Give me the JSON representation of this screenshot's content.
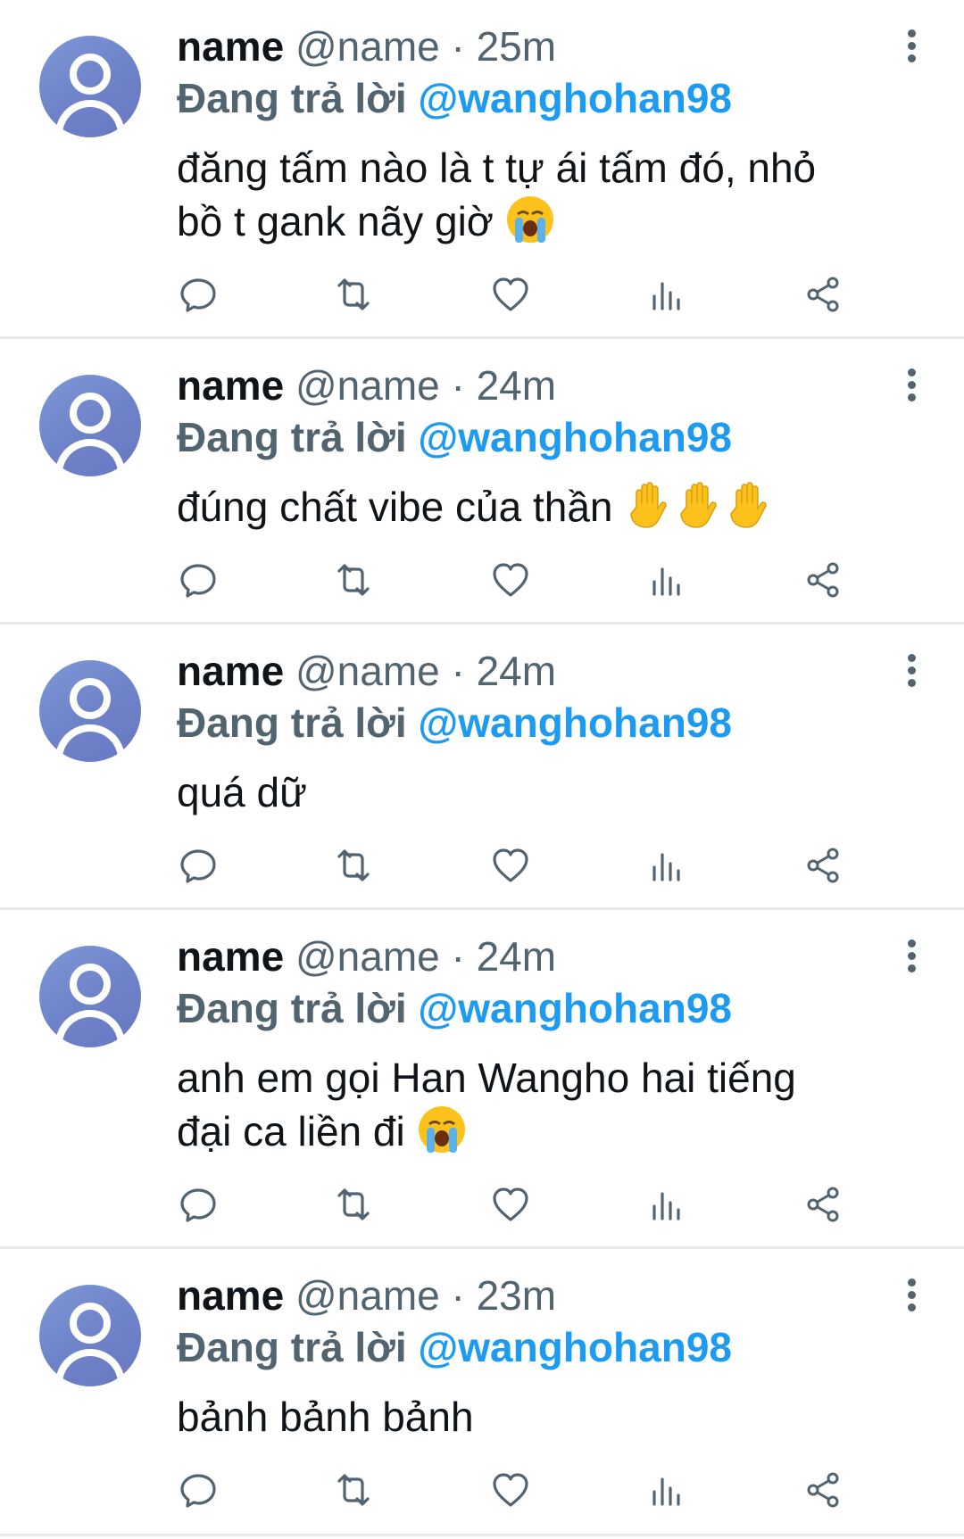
{
  "tweets": [
    {
      "name": "name",
      "handle": "@name",
      "time": "· 25m",
      "reply_prefix": "Đang trả lời",
      "reply_to": "@wanghohan98",
      "text_lines": [
        "đăng tấm nào là t tự ái tấm đó, nhỏ",
        "bồ t gank nãy giờ"
      ],
      "emojis": [
        "crying-face"
      ]
    },
    {
      "name": "name",
      "handle": "@name",
      "time": "· 24m",
      "reply_prefix": "Đang trả lời",
      "reply_to": "@wanghohan98",
      "text_lines": [
        "đúng chất vibe của thần"
      ],
      "emojis": [
        "raised-hand",
        "raised-hand",
        "raised-hand"
      ]
    },
    {
      "name": "name",
      "handle": "@name",
      "time": "· 24m",
      "reply_prefix": "Đang trả lời",
      "reply_to": "@wanghohan98",
      "text_lines": [
        "quá dữ"
      ],
      "emojis": []
    },
    {
      "name": "name",
      "handle": "@name",
      "time": "· 24m",
      "reply_prefix": "Đang trả lời",
      "reply_to": "@wanghohan98",
      "text_lines": [
        "anh em gọi Han Wangho hai tiếng",
        "đại ca liền đi"
      ],
      "emojis": [
        "crying-face"
      ]
    },
    {
      "name": "name",
      "handle": "@name",
      "time": "· 23m",
      "reply_prefix": "Đang trả lời",
      "reply_to": "@wanghohan98",
      "text_lines": [
        "bảnh bảnh bảnh"
      ],
      "emojis": []
    }
  ],
  "action_icons": [
    "reply-icon",
    "retweet-icon",
    "like-icon",
    "analytics-icon",
    "share-icon"
  ],
  "colors": {
    "text": "#0f1419",
    "secondary": "#536471",
    "mention": "#1d9bf0",
    "divider": "#e7eaed"
  }
}
